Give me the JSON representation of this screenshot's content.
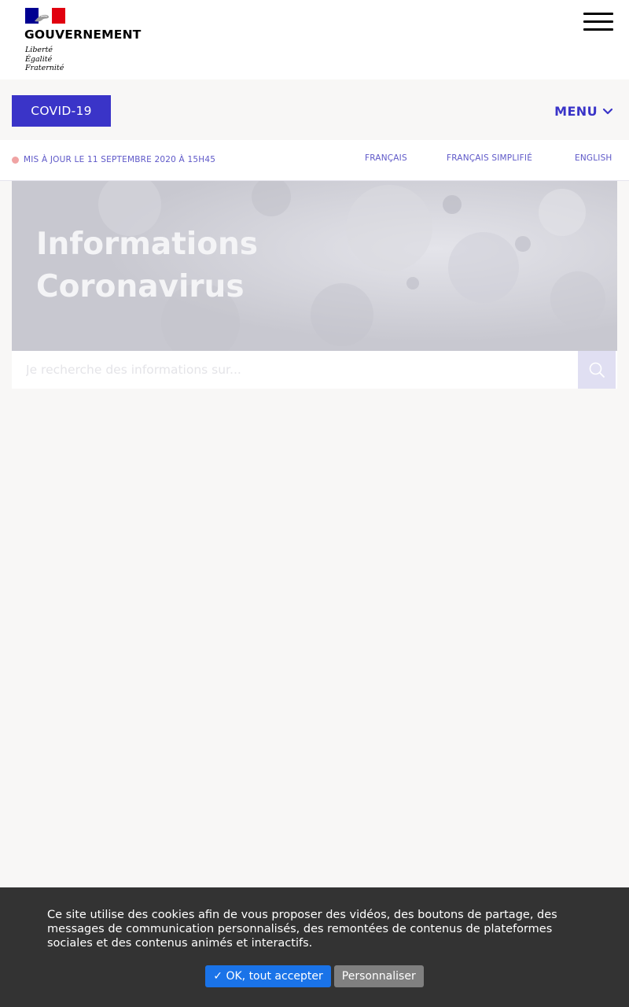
{
  "header": {
    "logo_title": "GOUVERNEMENT",
    "logo_motto": [
      "Liberté",
      "Égalité",
      "Fraternité"
    ],
    "menu_icon": "hamburger-icon"
  },
  "nav": {
    "covid_label": "COVID-19",
    "menu_label": "MENU",
    "menu_icon": "chevron-down-icon"
  },
  "info": {
    "update_text": "MIS À JOUR LE 11 SEPTEMBRE 2020 À 15H45",
    "languages": [
      "FRANÇAIS",
      "FRANÇAIS SIMPLIFIÉ",
      "ENGLISH"
    ]
  },
  "hero": {
    "title_lines": [
      "Informations",
      "Coronavirus"
    ]
  },
  "search": {
    "placeholder": "Je recherche des informations sur...",
    "button_icon": "search-icon"
  },
  "cookie": {
    "text": "Ce site utilise des cookies afin de vous proposer des vidéos, des boutons de partage, des messages de communication personnalisés, des remontées de contenus de plateformes sociales et des contenus animés et interactifs.",
    "accept_label": "✓ OK, tout accepter",
    "customize_label": "Personnaliser"
  },
  "colors": {
    "primary": "#3a34c8",
    "link": "#5e58c8",
    "update_dot": "#f0a3a3",
    "hero_bg": "#cdcdd4",
    "cookie_bg": "#333333",
    "accept_button": "#1a73e8",
    "customize_button": "#808080"
  }
}
